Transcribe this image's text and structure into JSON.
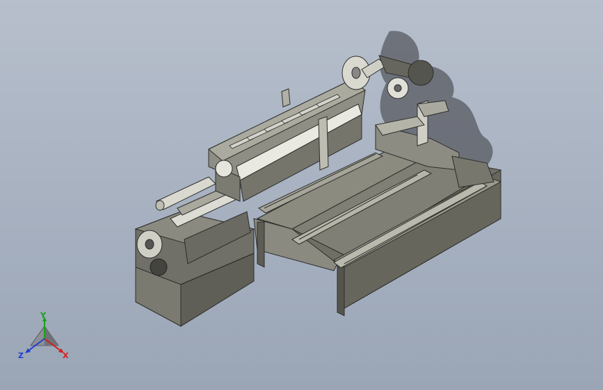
{
  "viewport": {
    "background_top": "#b7bfcc",
    "background_bottom": "#9aa5b6"
  },
  "triad": {
    "x_label": "X",
    "y_label": "Y",
    "z_label": "Z",
    "x_color": "#d11f1f",
    "y_color": "#1aa11a",
    "z_color": "#1f3fd1"
  }
}
